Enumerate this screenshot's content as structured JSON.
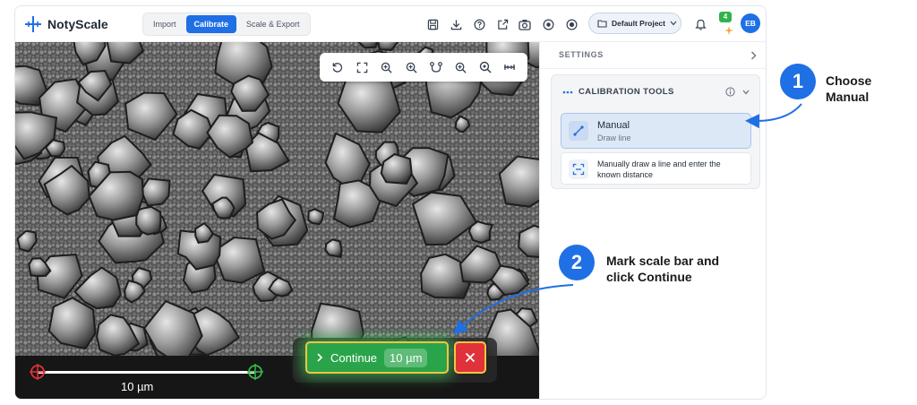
{
  "app": {
    "name": "NotyScale",
    "modes": [
      "Import",
      "Calibrate",
      "Scale & Export"
    ],
    "active_mode": "Calibrate",
    "project": "Default Project",
    "notification_count": "4",
    "user_initials": "EB"
  },
  "canvas": {
    "scale_label": "10 µm",
    "continue_label": "Continue",
    "measure_value": "10 µm"
  },
  "settings": {
    "header": "SETTINGS",
    "section_title": "CALIBRATION TOOLS",
    "options": [
      {
        "title": "Manual",
        "subtitle": "Draw line"
      },
      {
        "text": "Manually draw a line and enter the known distance"
      }
    ]
  },
  "annotations": {
    "step1_number": "1",
    "step1_text": [
      "Choose",
      "Manual"
    ],
    "step2_number": "2",
    "step2_text": [
      "Mark scale bar and",
      "click Continue"
    ]
  },
  "colors": {
    "accent": "#1f6fe5",
    "continue": "#2aa44a",
    "cancel": "#e0323a",
    "highlight": "#f2c542"
  }
}
